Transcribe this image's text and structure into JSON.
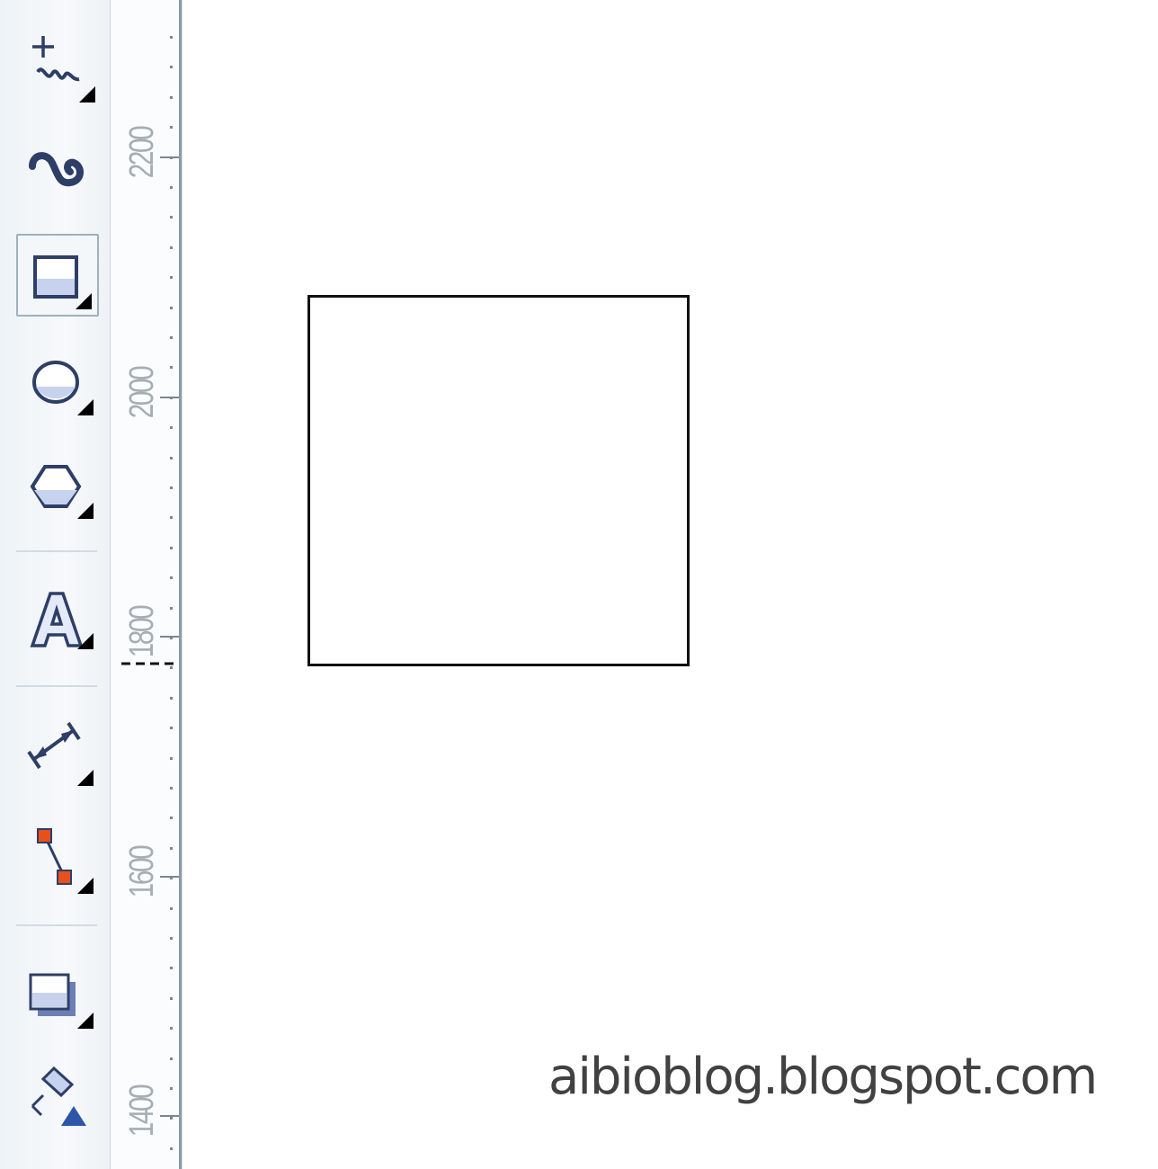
{
  "toolbox": {
    "tools": [
      {
        "name": "freehand-tool-icon",
        "active": false,
        "flyout": true
      },
      {
        "name": "smart-fill-tool-icon",
        "active": false,
        "flyout": false
      },
      {
        "name": "rectangle-tool-icon",
        "active": true,
        "flyout": true
      },
      {
        "name": "ellipse-tool-icon",
        "active": false,
        "flyout": true
      },
      {
        "name": "polygon-tool-icon",
        "active": false,
        "flyout": true
      },
      {
        "name": "text-tool-icon",
        "active": false,
        "flyout": true
      },
      {
        "name": "dimension-tool-icon",
        "active": false,
        "flyout": true
      },
      {
        "name": "connector-tool-icon",
        "active": false,
        "flyout": true
      },
      {
        "name": "drop-shadow-tool-icon",
        "active": false,
        "flyout": true
      },
      {
        "name": "fill-tool-icon",
        "active": false,
        "flyout": false
      }
    ]
  },
  "ruler": {
    "labels": [
      "2200",
      "2000",
      "1800",
      "1600",
      "1400"
    ]
  },
  "canvas": {
    "shape": "rectangle",
    "stroke_color": "#111111"
  },
  "watermark": {
    "text": "aibioblog.blogspot.com"
  },
  "colors": {
    "toolbox_bg": "#eef3f7",
    "icon_blue": "#2d3e67",
    "icon_fill": "#d9e3f4",
    "connector_node": "#e8501b"
  }
}
